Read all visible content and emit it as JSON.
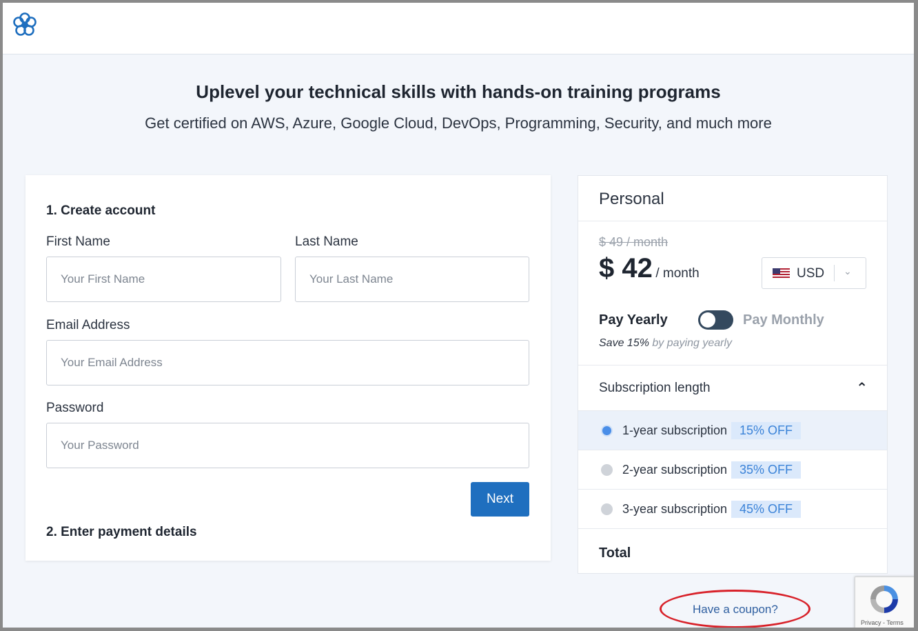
{
  "logo": {
    "icon": "flower-logo-icon",
    "color": "#1f6fbf"
  },
  "hero": {
    "title": "Uplevel your technical skills with hands-on training programs",
    "subtitle": "Get certified on AWS, Azure, Google Cloud, DevOps, Programming, Security, and much more"
  },
  "signup": {
    "step1_title": "1. Create account",
    "first_name_label": "First Name",
    "first_name_placeholder": "Your First Name",
    "last_name_label": "Last Name",
    "last_name_placeholder": "Your Last Name",
    "email_label": "Email Address",
    "email_placeholder": "Your Email Address",
    "password_label": "Password",
    "password_placeholder": "Your Password",
    "next_label": "Next",
    "step2_title": "2. Enter payment details"
  },
  "plan": {
    "name": "Personal",
    "old_price": "$ 49 / month",
    "price": "$ 42",
    "price_unit": "/ month",
    "currency": "USD",
    "pay_yearly": "Pay Yearly",
    "pay_monthly": "Pay Monthly",
    "save_strong": "Save 15%",
    "save_rest": "by paying yearly",
    "subscription_title": "Subscription length",
    "options": [
      {
        "label": "1-year subscription",
        "badge": "15% OFF",
        "selected": true
      },
      {
        "label": "2-year subscription",
        "badge": "35% OFF",
        "selected": false
      },
      {
        "label": "3-year subscription",
        "badge": "45% OFF",
        "selected": false
      }
    ],
    "total_label": "Total"
  },
  "coupon": {
    "label": "Have a coupon?"
  },
  "recaptcha": {
    "text": "Privacy - Terms"
  },
  "colors": {
    "accent": "#1f6fbf",
    "highlight_ring": "#d8222a"
  }
}
